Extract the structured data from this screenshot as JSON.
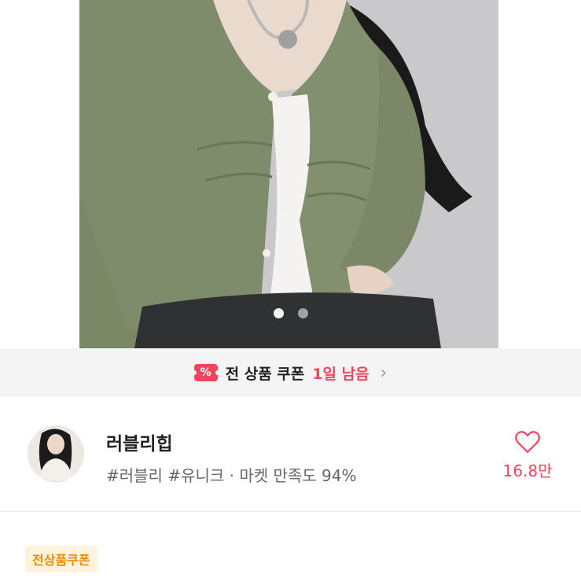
{
  "product": {
    "image_alt": "green ruched cardigan photo",
    "carousel": {
      "count": 2,
      "active": 0
    }
  },
  "coupon_bar": {
    "icon": "%",
    "text": "전 상품 쿠폰",
    "days_left": "1일 남음",
    "chevron": "›"
  },
  "shop": {
    "name": "러블리힙",
    "tags": "#러블리 #유니크 · 마켓 만족도 94%",
    "like_count": "16.8만"
  },
  "badge": {
    "label": "전상품쿠폰"
  },
  "colors": {
    "accent": "#f0455c",
    "badge_text": "#f08a00",
    "badge_bg": "#fff3de"
  }
}
